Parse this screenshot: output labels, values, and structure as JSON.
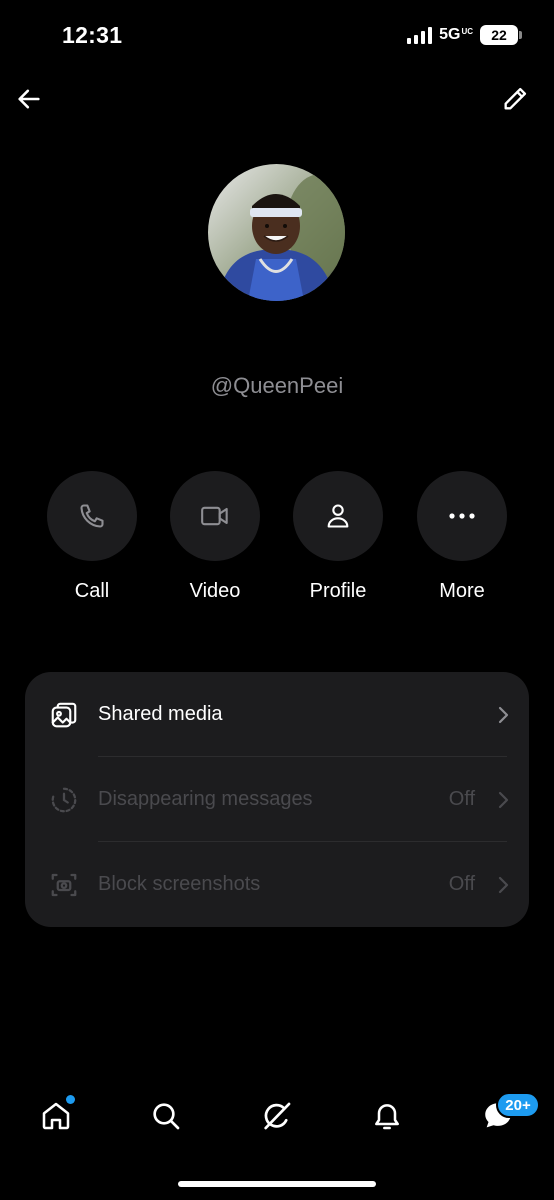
{
  "status_bar": {
    "time": "12:31",
    "network": "5G",
    "network_suffix": "UC",
    "battery": "22"
  },
  "header": {
    "back_icon": "arrow-left-icon",
    "edit_icon": "pencil-icon"
  },
  "profile": {
    "handle": "@QueenPeei",
    "avatar": "profile-photo"
  },
  "actions": [
    {
      "label": "Call",
      "icon": "phone-icon"
    },
    {
      "label": "Video",
      "icon": "video-camera-icon"
    },
    {
      "label": "Profile",
      "icon": "person-icon"
    },
    {
      "label": "More",
      "icon": "more-dots-icon"
    }
  ],
  "settings": [
    {
      "label": "Shared media",
      "value": "",
      "icon": "gallery-icon"
    },
    {
      "label": "Disappearing messages",
      "value": "Off",
      "icon": "timer-icon"
    },
    {
      "label": "Block screenshots",
      "value": "Off",
      "icon": "camera-frame-icon"
    }
  ],
  "bottom_nav": {
    "items": [
      "home-icon",
      "search-icon",
      "grok-icon",
      "bell-icon",
      "messages-icon"
    ],
    "messages_badge": "20+"
  },
  "colors": {
    "background": "#000000",
    "surface": "#1c1c1e",
    "accent": "#1d9bf0",
    "muted_text": "#8e8e93",
    "disabled_text": "#4a4a4e"
  }
}
